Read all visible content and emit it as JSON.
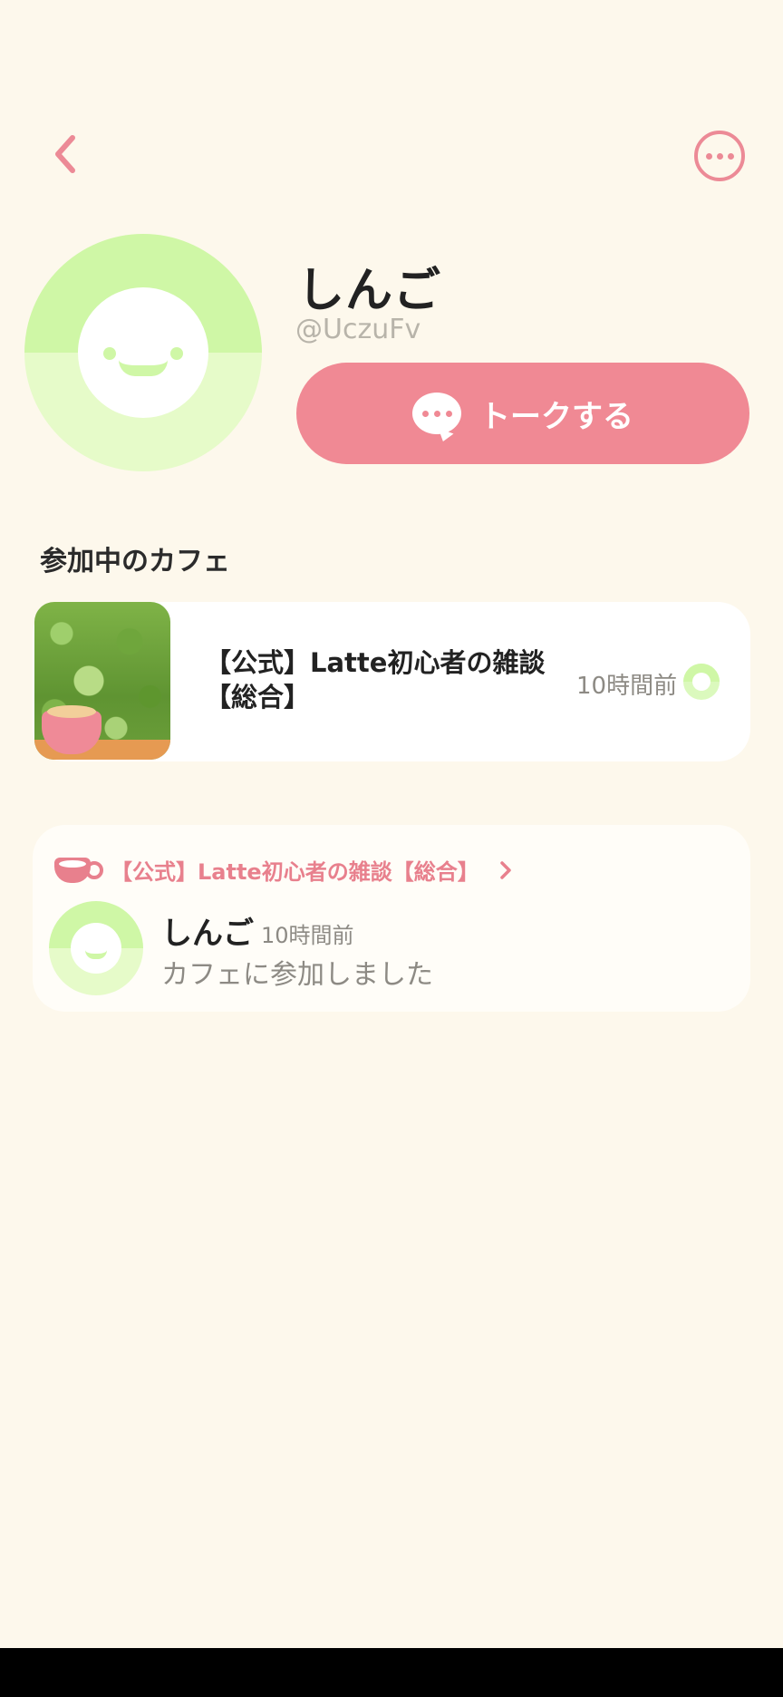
{
  "header": {
    "back_icon": "chevron-left-icon",
    "more_icon": "more-horizontal-icon",
    "accent_color": "#ec8a96"
  },
  "profile": {
    "display_name": "しんご",
    "handle": "@UczuFv",
    "talk_button_label": "トークする",
    "talk_icon": "chat-bubble-icon"
  },
  "cafes_section": {
    "title": "参加中のカフェ",
    "items": [
      {
        "name": "【公式】Latte初心者の雑談【総合】",
        "time": "10時間前"
      }
    ]
  },
  "activity": {
    "cafe_title": "【公式】Latte初心者の雑談【総合】",
    "user_name": "しんご",
    "time": "10時間前",
    "message": "カフェに参加しました"
  }
}
